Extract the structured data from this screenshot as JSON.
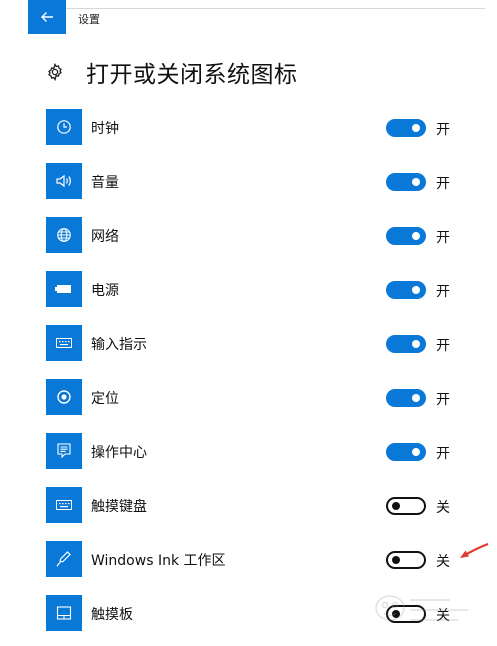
{
  "window": {
    "title": "设置"
  },
  "page": {
    "title": "打开或关闭系统图标"
  },
  "colors": {
    "accent": "#0a78d7",
    "annotation_arrow": "#e03b2e"
  },
  "items": [
    {
      "label": "时钟",
      "icon": "clock-icon",
      "state": "开",
      "on": true
    },
    {
      "label": "音量",
      "icon": "volume-icon",
      "state": "开",
      "on": true
    },
    {
      "label": "网络",
      "icon": "globe-icon",
      "state": "开",
      "on": true
    },
    {
      "label": "电源",
      "icon": "battery-icon",
      "state": "开",
      "on": true
    },
    {
      "label": "输入指示",
      "icon": "keyboard-icon",
      "state": "开",
      "on": true
    },
    {
      "label": "定位",
      "icon": "location-icon",
      "state": "开",
      "on": true
    },
    {
      "label": "操作中心",
      "icon": "action-center-icon",
      "state": "开",
      "on": true
    },
    {
      "label": "触摸键盘",
      "icon": "touch-keyboard-icon",
      "state": "关",
      "on": false
    },
    {
      "label": "Windows Ink 工作区",
      "icon": "pen-icon",
      "state": "关",
      "on": false
    },
    {
      "label": "触摸板",
      "icon": "touchpad-icon",
      "state": "关",
      "on": false
    }
  ]
}
